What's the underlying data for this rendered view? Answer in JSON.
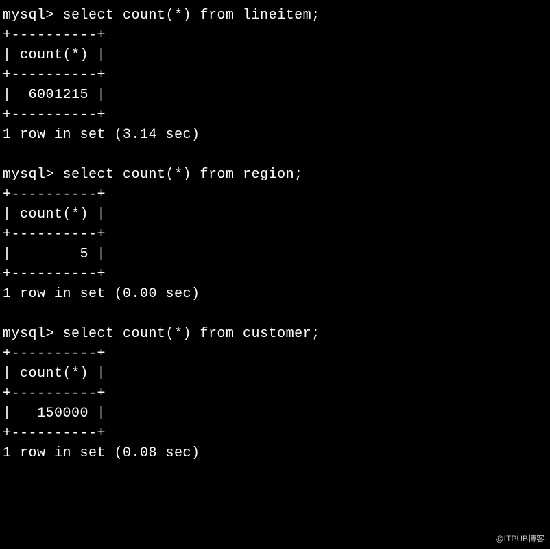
{
  "prompt": "mysql> ",
  "queries": [
    {
      "command": "select count(*) from lineitem;",
      "border": "+----------+",
      "header": "| count(*) |",
      "value_row": "|  6001215 |",
      "result_msg": "1 row in set (3.14 sec)"
    },
    {
      "command": "select count(*) from region;",
      "border": "+----------+",
      "header": "| count(*) |",
      "value_row": "|        5 |",
      "result_msg": "1 row in set (0.00 sec)"
    },
    {
      "command": "select count(*) from customer;",
      "border": "+----------+",
      "header": "| count(*) |",
      "value_row": "|   150000 |",
      "result_msg": "1 row in set (0.08 sec)"
    }
  ],
  "watermark": "@ITPUB博客"
}
